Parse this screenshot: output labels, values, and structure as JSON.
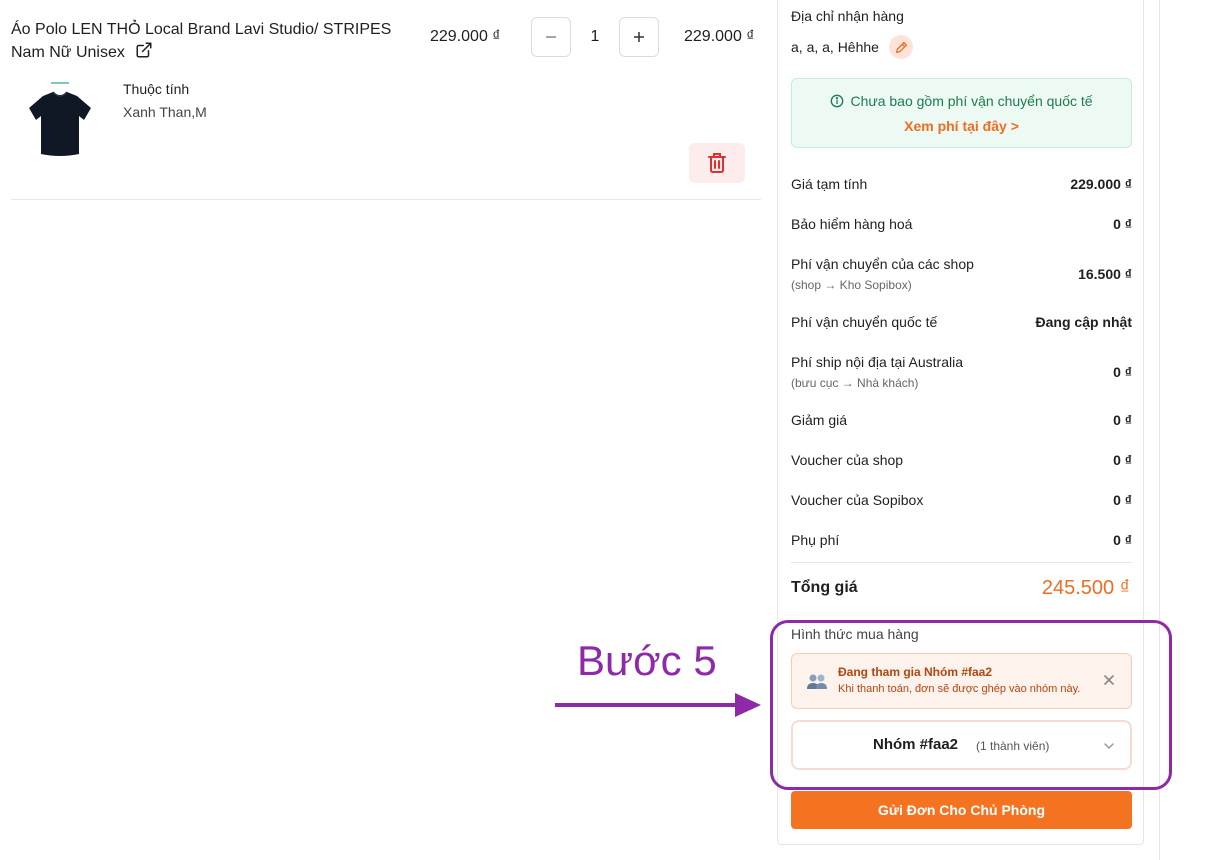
{
  "cart_item": {
    "title": "Áo Polo LEN THỎ Local Brand Lavi Studio/ STRIPES Nam Nữ Unisex",
    "unit_price": "229.000 ₫",
    "quantity": "1",
    "line_total": "229.000 ₫",
    "attr_label": "Thuộc tính",
    "attr_value": "Xanh Than,M"
  },
  "summary": {
    "address_label": "Địa chỉ nhận hàng",
    "address_value": "a, a, a, Hêhhe",
    "notice_text": "Chưa bao gồm phí vận chuyển quốc tế",
    "notice_link": "Xem phí tại đây >",
    "rows": [
      {
        "label": "Giá tạm tính",
        "sub": "",
        "value": "229.000 ₫"
      },
      {
        "label": "Bảo hiểm hàng hoá",
        "sub": "",
        "value": "0 ₫"
      },
      {
        "label": "Phí vận chuyển của các shop",
        "sub": "(shop → Kho Sopibox)",
        "value": "16.500 ₫"
      },
      {
        "label": "Phí vận chuyển quốc tế",
        "sub": "",
        "value": "Đang cập nhật"
      },
      {
        "label": "Phí ship nội địa tại Australia",
        "sub": "(bưu cục → Nhà khách)",
        "value": "0 ₫"
      },
      {
        "label": "Giảm giá",
        "sub": "",
        "value": "0 ₫"
      },
      {
        "label": "Voucher của shop",
        "sub": "",
        "value": "0 ₫"
      },
      {
        "label": "Voucher của Sopibox",
        "sub": "",
        "value": "0 ₫"
      },
      {
        "label": "Phụ phí",
        "sub": "",
        "value": "0 ₫"
      }
    ],
    "total_label": "Tổng giá",
    "total_value": "245.500 ₫",
    "buy_method_label": "Hình thức mua hàng",
    "group_title": "Đang tham gia Nhóm #faa2",
    "group_desc": "Khi thanh toán, đơn sẽ được ghép vào nhóm này.",
    "group_select_name": "Nhóm #faa2",
    "group_select_count": "(1 thành viên)",
    "submit_label": "Gửi Đơn Cho Chủ Phòng"
  },
  "annotation": {
    "step_label": "Bước 5"
  },
  "colors": {
    "accent": "#f47321",
    "annotation": "#8e2aa8",
    "notice_green": "#1e7a4c"
  },
  "icons": [
    "external-link-icon",
    "minus-icon",
    "plus-icon",
    "trash-icon",
    "pencil-icon",
    "info-icon",
    "group-users-icon",
    "close-icon",
    "chevron-down-icon"
  ]
}
